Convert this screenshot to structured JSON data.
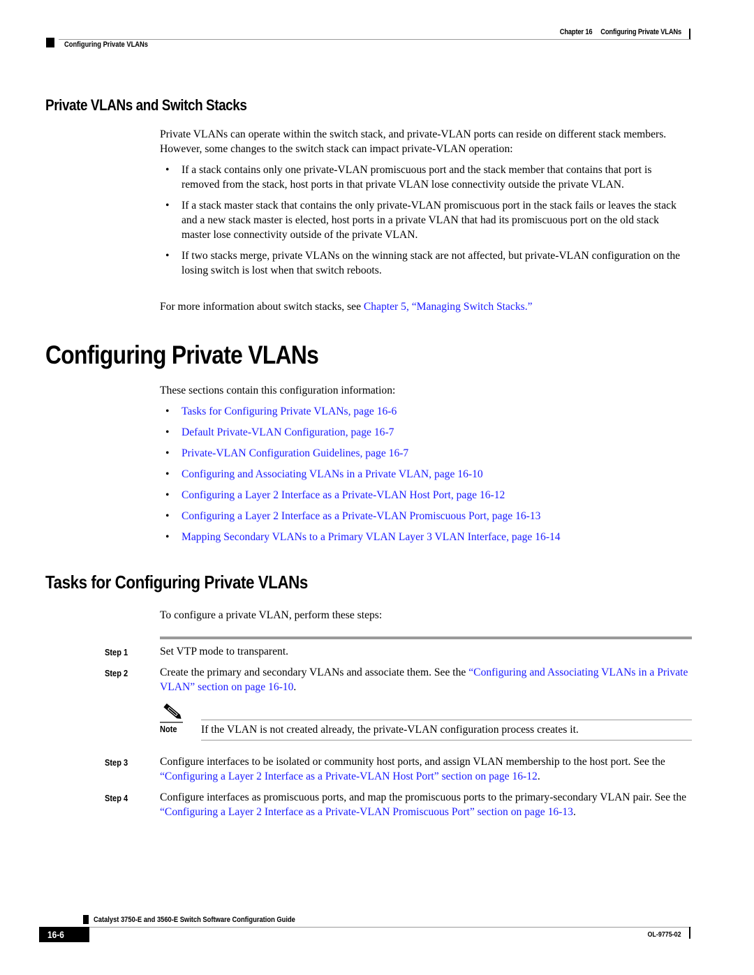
{
  "header": {
    "chapter_label": "Chapter 16",
    "chapter_title": "Configuring Private VLANs",
    "section_title": "Configuring Private VLANs"
  },
  "section_stacks": {
    "heading": "Private VLANs and Switch Stacks",
    "intro": "Private VLANs can operate within the switch stack, and private-VLAN ports can reside on different stack members. However, some changes to the switch stack can impact private-VLAN operation:",
    "bullets": [
      "If a stack contains only one private-VLAN promiscuous port and the stack member that contains that port is removed from the stack, host ports in that private VLAN lose connectivity outside the private VLAN.",
      "If a stack master stack that contains the only private-VLAN promiscuous port in the stack fails or leaves the stack and a new stack master is elected, host ports in a private VLAN that had its promiscuous port on the old stack master lose connectivity outside of the private VLAN.",
      "If two stacks merge, private VLANs on the winning stack are not affected, but private-VLAN configuration on the losing switch is lost when that switch reboots."
    ],
    "more_info_prefix": "For more information about switch stacks, see ",
    "more_info_link": "Chapter 5, “Managing Switch Stacks.”"
  },
  "section_configuring": {
    "heading": "Configuring Private VLANs",
    "intro": "These sections contain this configuration information:",
    "toc": [
      "Tasks for Configuring Private VLANs, page 16-6",
      "Default Private-VLAN Configuration, page 16-7",
      "Private-VLAN Configuration Guidelines, page 16-7",
      "Configuring and Associating VLANs in a Private VLAN, page 16-10",
      "Configuring a Layer 2 Interface as a Private-VLAN Host Port, page 16-12",
      "Configuring a Layer 2 Interface as a Private-VLAN Promiscuous Port, page 16-13",
      "Mapping Secondary VLANs to a Primary VLAN Layer 3 VLAN Interface, page 16-14"
    ]
  },
  "section_tasks": {
    "heading": "Tasks for Configuring Private VLANs",
    "intro": "To configure a private VLAN, perform these steps:",
    "steps": [
      {
        "label": "Step 1",
        "text": "Set VTP mode to transparent."
      },
      {
        "label": "Step 2",
        "text_prefix": "Create the primary and secondary VLANs and associate them. See the ",
        "link": "“Configuring and Associating VLANs in a Private VLAN” section on page 16-10",
        "text_suffix": "."
      },
      {
        "label": "Step 3",
        "text_prefix": "Configure interfaces to be isolated or community host ports, and assign VLAN membership to the host port. See the ",
        "link": "“Configuring a Layer 2 Interface as a Private-VLAN Host Port” section on page 16-12",
        "text_suffix": "."
      },
      {
        "label": "Step 4",
        "text_prefix": "Configure interfaces as promiscuous ports, and map the promiscuous ports to the primary-secondary VLAN pair. See the ",
        "link": "“Configuring a Layer 2 Interface as a Private-VLAN Promiscuous Port” section on page 16-13",
        "text_suffix": "."
      }
    ],
    "note": {
      "label": "Note",
      "icon": "pencil-note-icon",
      "text": "If the VLAN is not created already, the private-VLAN configuration process creates it."
    }
  },
  "footer": {
    "guide_title": "Catalyst 3750-E and 3560-E Switch Software Configuration Guide",
    "page_number": "16-6",
    "doc_number": "OL-9775-02"
  },
  "colors": {
    "link": "#1a1aff",
    "rule": "#9a9a9a",
    "text": "#000000"
  }
}
